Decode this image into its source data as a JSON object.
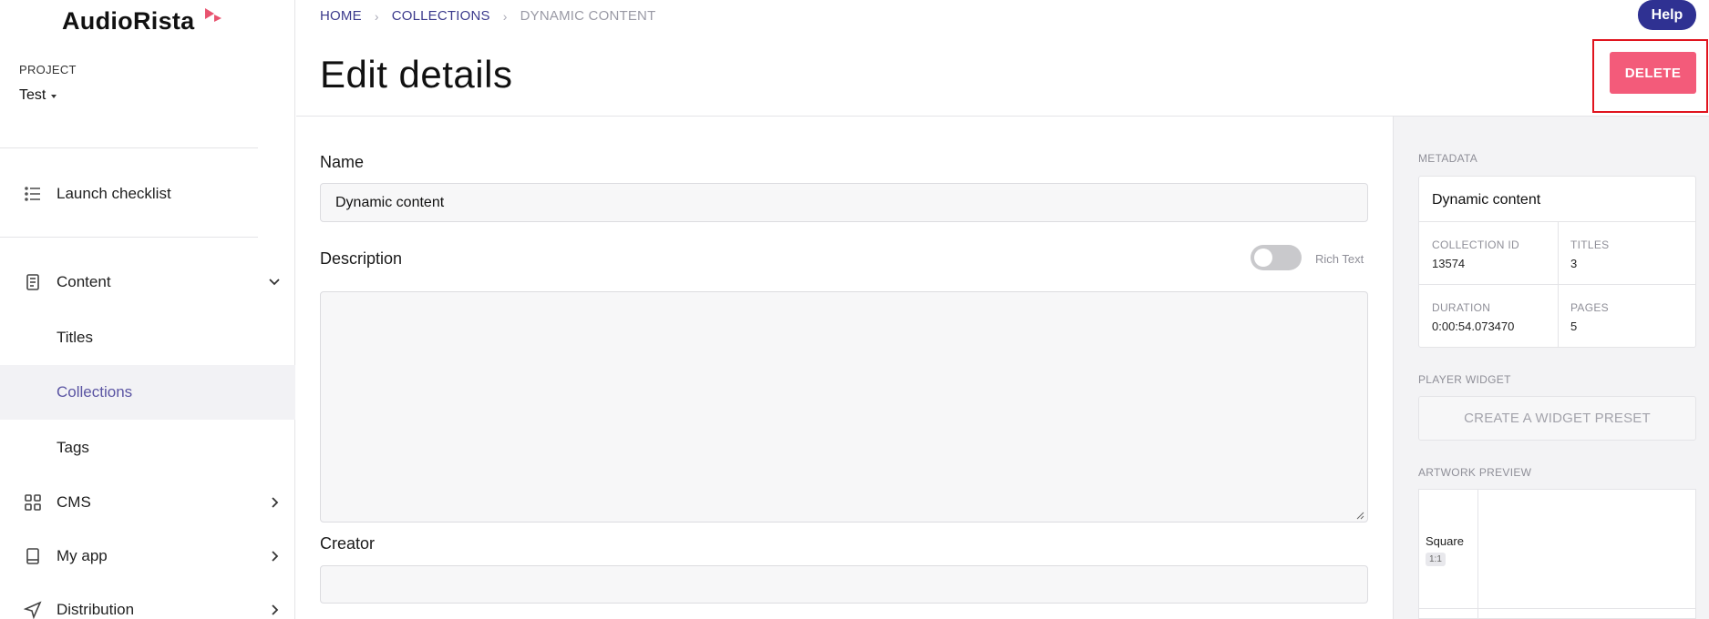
{
  "app": {
    "name": "AudioRista"
  },
  "sidebar": {
    "project_label": "PROJECT",
    "project_value": "Test",
    "launch_checklist": "Launch checklist",
    "items": [
      {
        "label": "Content"
      },
      {
        "label": "Titles"
      },
      {
        "label": "Collections"
      },
      {
        "label": "Tags"
      },
      {
        "label": "CMS"
      },
      {
        "label": "My app"
      },
      {
        "label": "Distribution"
      }
    ]
  },
  "breadcrumb": [
    "HOME",
    "COLLECTIONS",
    "DYNAMIC CONTENT"
  ],
  "header": {
    "title": "Edit details",
    "help": "Help",
    "delete": "DELETE"
  },
  "form": {
    "name_label": "Name",
    "name_value": "Dynamic content",
    "description_label": "Description",
    "rich_text_label": "Rich Text",
    "creator_label": "Creator",
    "creator_value": ""
  },
  "metadata": {
    "section_label": "METADATA",
    "title": "Dynamic content",
    "collection_id_label": "COLLECTION ID",
    "collection_id": "13574",
    "titles_label": "TITLES",
    "titles": "3",
    "duration_label": "DURATION",
    "duration": "0:00:54.073470",
    "pages_label": "PAGES",
    "pages": "5"
  },
  "widget": {
    "section_label": "PLAYER WIDGET",
    "button": "CREATE A WIDGET PRESET"
  },
  "artwork": {
    "section_label": "ARTWORK PREVIEW",
    "square_label": "Square",
    "ratio": "1:1"
  },
  "colors": {
    "accent": "#3b3a8c",
    "delete": "#f35b7a",
    "help": "#2f3192",
    "active_nav": "#5b55a3"
  }
}
